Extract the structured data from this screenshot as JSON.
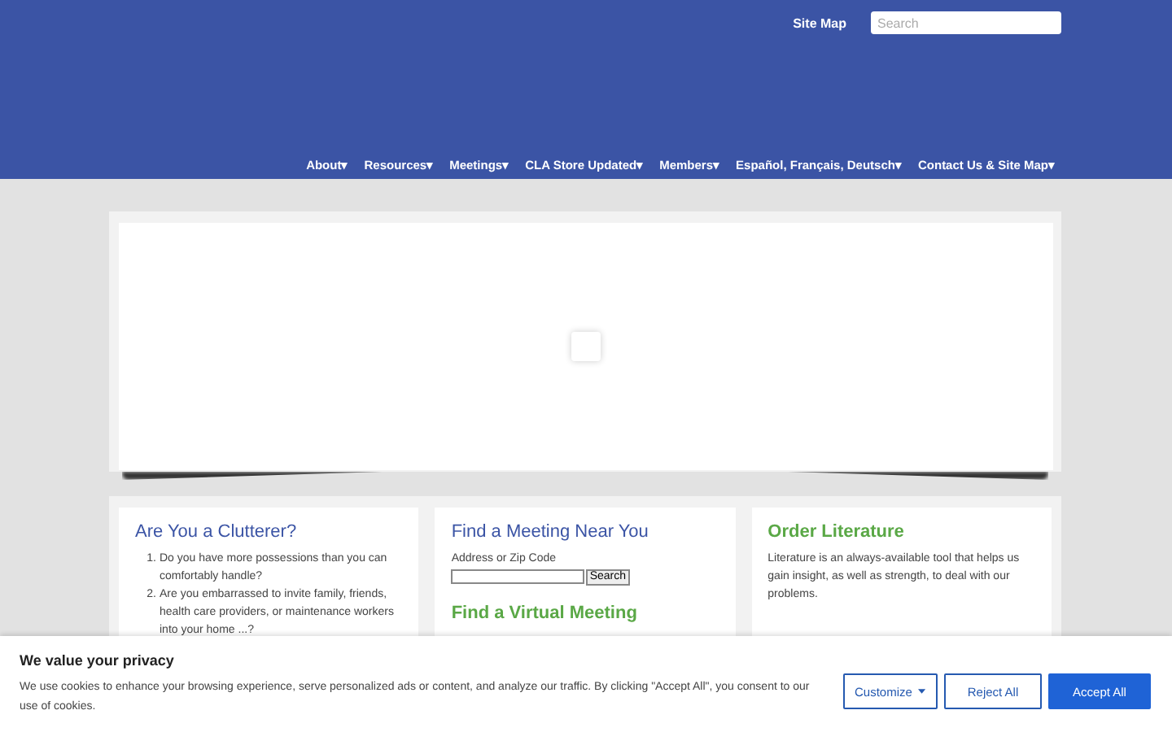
{
  "header": {
    "site_map_link": "Site Map",
    "search": {
      "placeholder": "Search"
    }
  },
  "nav": [
    {
      "label": "About",
      "caret": "▾"
    },
    {
      "label": "Resources",
      "caret": "▾"
    },
    {
      "label": "Meetings",
      "caret": "▾"
    },
    {
      "label": "CLA Store Updated",
      "caret": "▾"
    },
    {
      "label": "Members",
      "caret": "▾"
    },
    {
      "label": "Español, Français, Deutsch",
      "caret": "▾"
    },
    {
      "label": "Contact Us & Site Map",
      "caret": "▾"
    }
  ],
  "slider": {
    "loading": true
  },
  "cards": [
    {
      "kind": "list",
      "title": "Are You a Clutterer?",
      "items": [
        {
          "number": "1.",
          "text": "Do you have more possessions than you can comfortably handle?"
        },
        {
          "number": "2.",
          "text": "Are you embarrassed to invite family, friends, health care providers, or maintenance workers into your home ...?"
        }
      ]
    },
    {
      "kind": "search",
      "title": "Find a Meeting Near You",
      "field_label": "Address or Zip Code",
      "button": "Search",
      "subtitle": "Find a Virtual Meeting"
    },
    {
      "kind": "text",
      "title": "Order Literature",
      "text": "Literature is an always-available tool that helps us gain insight, as well as strength, to deal with our problems."
    }
  ],
  "cookie_banner": {
    "title": "We value your privacy",
    "text": "We use cookies to enhance your browsing experience, serve personalized ads or content, and analyze our traffic. By clicking \"Accept All\", you consent to our use of cookies.",
    "buttons": [
      {
        "label": "Customize",
        "kind": "dropdown"
      },
      {
        "label": "Reject All",
        "kind": "outline"
      },
      {
        "label": "Accept All",
        "kind": "primary"
      }
    ]
  }
}
